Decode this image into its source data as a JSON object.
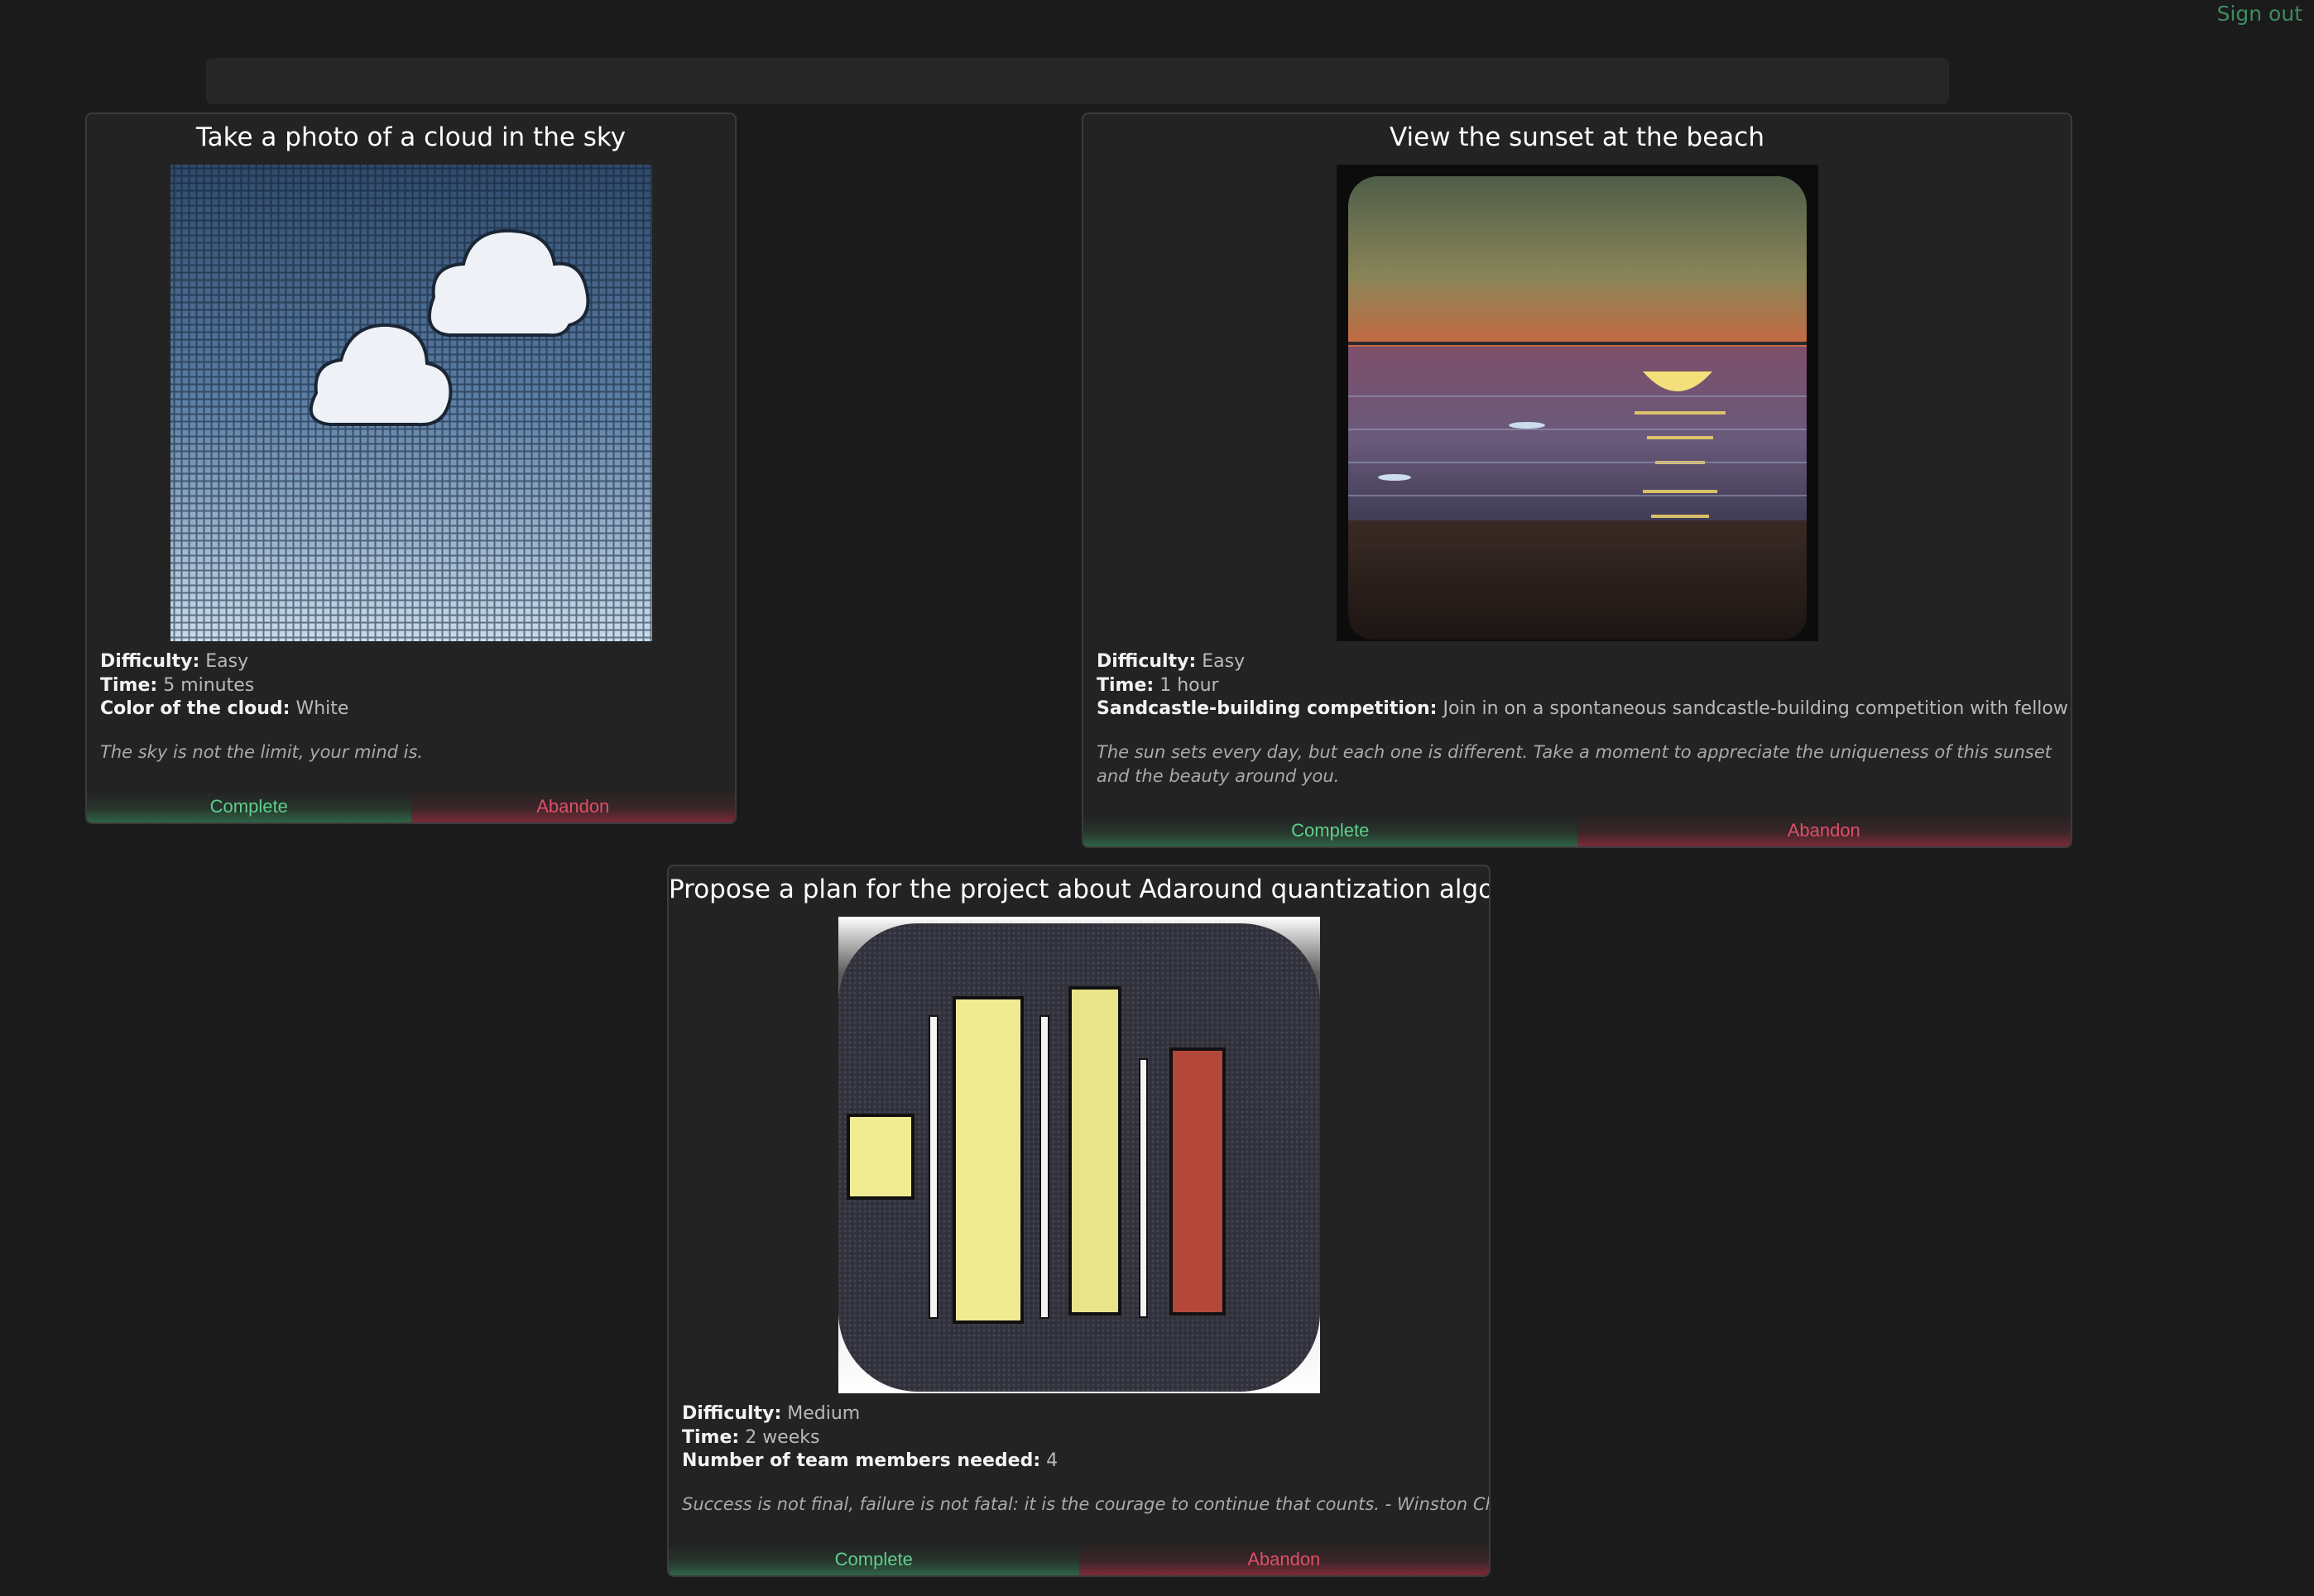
{
  "header": {
    "signout_label": "Sign out"
  },
  "colors": {
    "background": "#1b1b1b",
    "card": "#232323",
    "complete": "#5fcf8e",
    "abandon": "#e04f68",
    "signout": "#3f8b5f"
  },
  "quests": [
    {
      "title": "Take a photo of a cloud in the sky",
      "image": "cloud-sky-image",
      "fields": [
        {
          "label": "Difficulty:",
          "value": "Easy"
        },
        {
          "label": "Time:",
          "value": "5 minutes"
        },
        {
          "label": "Color of the cloud:",
          "value": "White"
        }
      ],
      "quote": "The sky is not the limit, your mind is.",
      "complete_label": "Complete",
      "abandon_label": "Abandon"
    },
    {
      "title": "View the sunset at the beach",
      "image": "beach-sunset-image",
      "fields": [
        {
          "label": "Difficulty:",
          "value": "Easy"
        },
        {
          "label": "Time:",
          "value": "1 hour"
        },
        {
          "label": "Sandcastle-building competition:",
          "value": "Join in on a spontaneous sandcastle-building competition with fellow beach-goers"
        }
      ],
      "quote": "The sun sets every day, but each one is different. Take a moment to appreciate the uniqueness of this sunset and the beauty around you.",
      "complete_label": "Complete",
      "abandon_label": "Abandon"
    },
    {
      "title": "Propose a plan for the project about Adaround quantization algorithm",
      "image": "bar-chart-icon-image",
      "fields": [
        {
          "label": "Difficulty:",
          "value": "Medium"
        },
        {
          "label": "Time:",
          "value": "2 weeks"
        },
        {
          "label": "Number of team members needed:",
          "value": "4"
        }
      ],
      "quote": "Success is not final, failure is not fatal: it is the courage to continue that counts. - Winston Churchill",
      "complete_label": "Complete",
      "abandon_label": "Abandon"
    }
  ]
}
